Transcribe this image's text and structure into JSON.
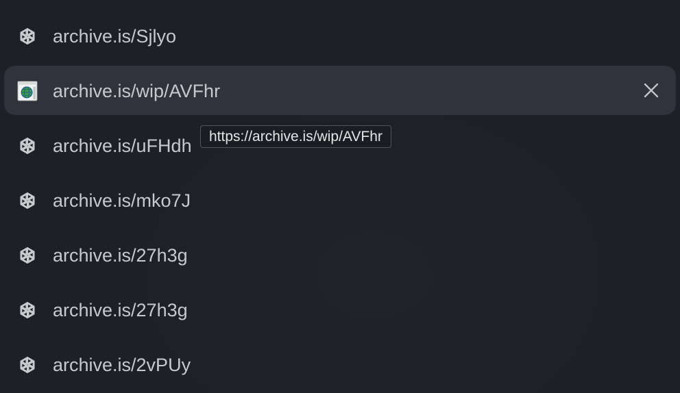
{
  "results": [
    {
      "label": "archive.is/Sjlyo",
      "icon": "openai-icon"
    },
    {
      "label": "archive.is/wip/AVFhr",
      "icon": "globe-page-icon",
      "selected": true
    },
    {
      "label": "archive.is/uFHdh",
      "icon": "openai-icon"
    },
    {
      "label": "archive.is/mko7J",
      "icon": "openai-icon"
    },
    {
      "label": "archive.is/27h3g",
      "icon": "openai-icon"
    },
    {
      "label": "archive.is/27h3g",
      "icon": "openai-icon"
    },
    {
      "label": "archive.is/2vPUy",
      "icon": "openai-icon"
    }
  ],
  "tooltip": {
    "text": "https://archive.is/wip/AVFhr"
  },
  "close_icon": "close-icon",
  "colors": {
    "background": "#1d2027",
    "selected_row": "#30333b",
    "text": "#c8c9cd"
  }
}
